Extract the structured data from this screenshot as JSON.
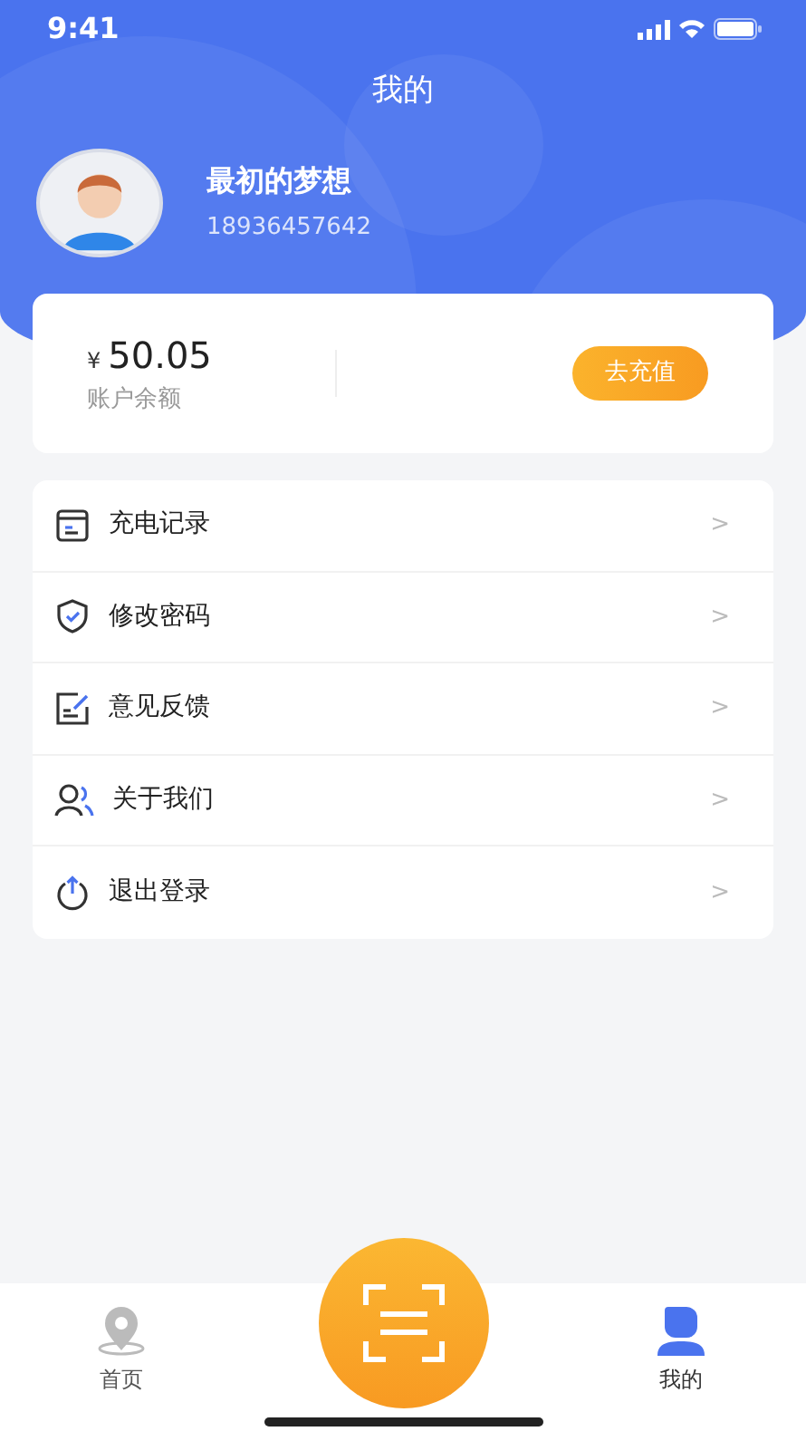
{
  "status_bar": {
    "time": "9:41"
  },
  "header": {
    "title": "我的"
  },
  "profile": {
    "name": "最初的梦想",
    "phone": "18936457642"
  },
  "balance": {
    "currency": "¥",
    "amount": "50.05",
    "label": "账户余额",
    "button": "去充值"
  },
  "menu": [
    {
      "kind": "record",
      "label": "充电记录",
      "chevron": ">"
    },
    {
      "kind": "shield",
      "label": "修改密码",
      "chevron": ">"
    },
    {
      "kind": "feedback",
      "label": "意见反馈",
      "chevron": ">"
    },
    {
      "kind": "people",
      "label": "关于我们",
      "chevron": ">"
    },
    {
      "kind": "logout",
      "label": "退出登录",
      "chevron": ">"
    }
  ],
  "tab_bar": [
    {
      "kind": "home",
      "label": "首页",
      "selected": false
    },
    {
      "kind": "scan"
    },
    {
      "kind": "mine",
      "label": "我的",
      "selected": true
    }
  ]
}
